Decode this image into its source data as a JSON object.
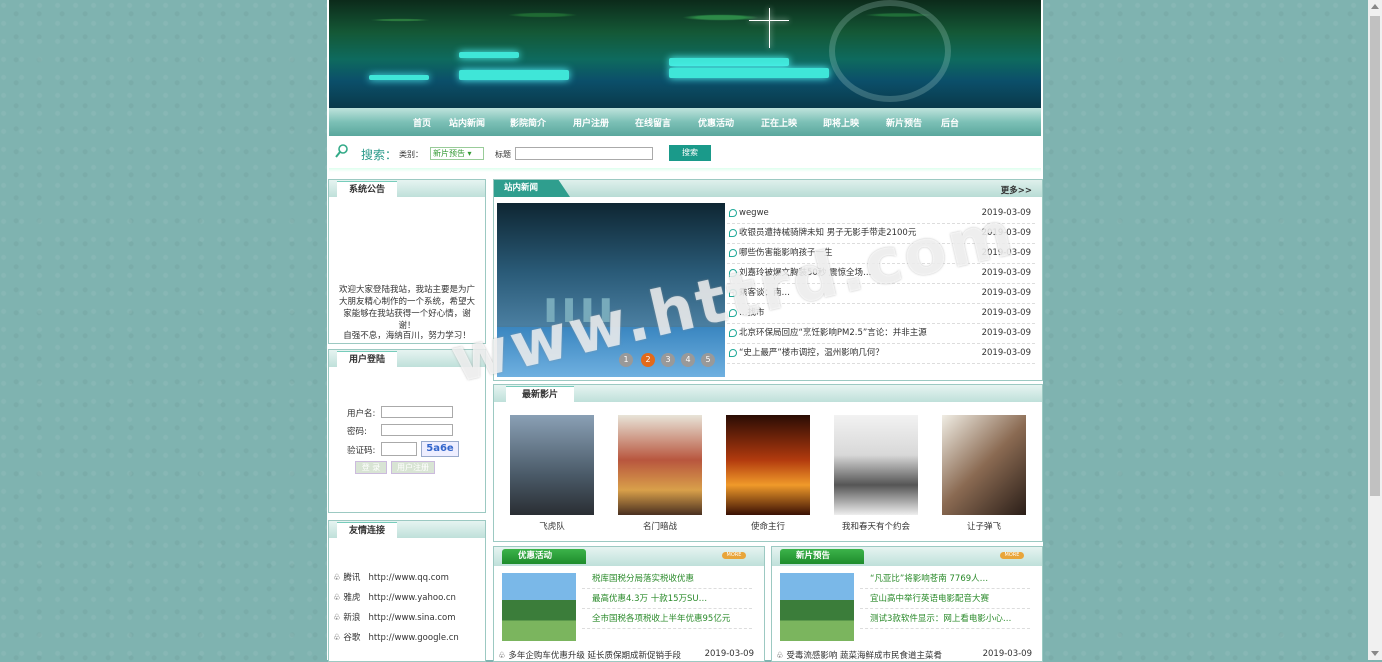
{
  "nav": {
    "items": [
      "首页",
      "站内新闻",
      "影院简介",
      "用户注册",
      "在线留言",
      "优惠活动",
      "正在上映",
      "即将上映",
      "新片预告",
      "后台"
    ]
  },
  "search": {
    "title": "搜索：",
    "category_label": "类别：",
    "category_value": "新片预告",
    "title_label": "标题",
    "button": "搜索"
  },
  "notice": {
    "header": "系统公告",
    "text": "欢迎大家登陆我站，我站主要是为广大朋友精心制作的一个系统，希望大家能够在我站获得一个好心情，谢谢！",
    "motto": "自强不息，海纳百川，努力学习！"
  },
  "login": {
    "header": "用户登陆",
    "username_label": "用户名:",
    "password_label": "密码:",
    "captcha_label": "验证码:",
    "captcha_value": "5a6e",
    "login_button": "登 录",
    "register_button": "用户注册"
  },
  "links": {
    "header": "友情连接",
    "items": [
      {
        "name": "腾讯",
        "url": "http://www.qq.com"
      },
      {
        "name": "雅虎",
        "url": "http://www.yahoo.cn"
      },
      {
        "name": "新浪",
        "url": "http://www.sina.com"
      },
      {
        "name": "谷歌",
        "url": "http://www.google.cn"
      }
    ]
  },
  "news": {
    "header": "站内新闻",
    "more": "更多>>",
    "slider_pages": [
      "1",
      "2",
      "3",
      "4",
      "5"
    ],
    "items": [
      {
        "title": "wegwe",
        "date": "2019-03-09"
      },
      {
        "title": "收银员遭持械骑牌未知 男子无影手带走2100元",
        "date": "2019-03-09"
      },
      {
        "title": "哪些伤害能影响孩子一生",
        "date": "2019-03-09"
      },
      {
        "title": "刘嘉玲被爆文胸装50秒 震惊全场…",
        "date": "2019-03-09"
      },
      {
        "title": "乘客谈：南…",
        "date": "2019-03-09"
      },
      {
        "title": "…找市",
        "date": "2019-03-09"
      },
      {
        "title": "北京环保局回应“烹饪影响PM2.5”言论：并非主源",
        "date": "2019-03-09"
      },
      {
        "title": "“史上最严”楼市调控，温州影响几何？",
        "date": "2019-03-09"
      }
    ]
  },
  "films": {
    "header": "最新影片",
    "items": [
      "飞虎队",
      "名门暗战",
      "使命主行",
      "我和春天有个约会",
      "让子弹飞"
    ]
  },
  "promo": {
    "header": "优惠活动",
    "more_badge": "MORE",
    "items": [
      "税库国税分局落实税收优惠",
      "最高优惠4.3万 十款15万SU…",
      "全市国税各项税收上半年优惠95亿元"
    ],
    "footer_title": "多年企购车优惠升级 延长质保期成新促销手段",
    "footer_date": "2019-03-09"
  },
  "trailer": {
    "header": "新片预告",
    "more_badge": "MORE",
    "items": [
      "“凡亚比”将影响苍南 7769人…",
      "宜山高中举行英语电影配音大赛",
      "测试3款软件显示：网上看电影小心…"
    ],
    "footer_title": "受毒流感影响 蔬菜海鲜成市民食道主菜肴",
    "footer_date": "2019-03-09"
  },
  "watermark": "www.httrd.com",
  "colors": {
    "accent": "#2a9a8a",
    "green_tab": "#1e8c2c",
    "background": "#7fb3b0"
  }
}
